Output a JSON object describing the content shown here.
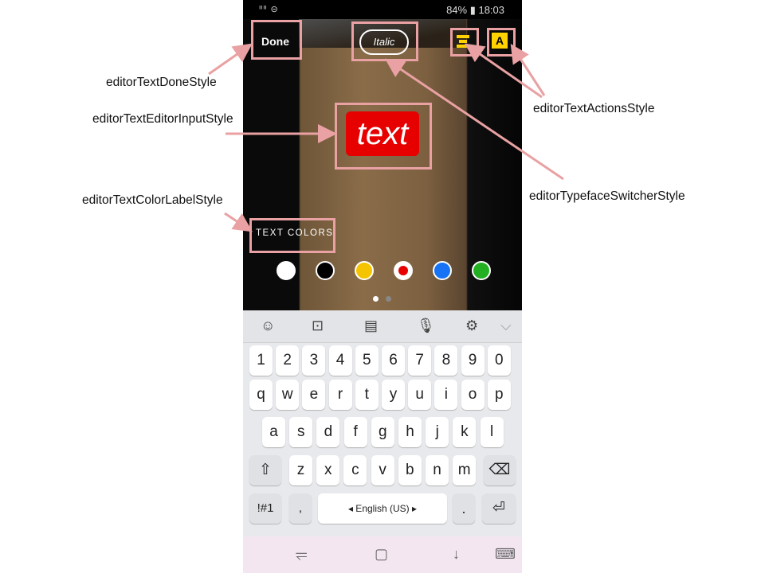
{
  "status_bar": {
    "left": "ᐦᐦ ⊝",
    "right": "84% ▮ 18:03"
  },
  "editor": {
    "done_label": "Done",
    "typeface_label": "Italic",
    "text_content": "text",
    "colors_label": "TEXT COLORS",
    "swatch_colors": [
      "#ffffff",
      "#000000",
      "#f5c400",
      "#e60000",
      "#1673f5",
      "#22b022"
    ],
    "selected_swatch": 3,
    "page_indicator": {
      "pages": 2,
      "current": 1
    }
  },
  "keyboard": {
    "toolbar_icons": [
      "emoji-icon",
      "sticker-icon",
      "clipboard-icon",
      "mic-icon",
      "settings-icon",
      "collapse-icon"
    ],
    "row_numbers": [
      "1",
      "2",
      "3",
      "4",
      "5",
      "6",
      "7",
      "8",
      "9",
      "0"
    ],
    "row1": [
      "q",
      "w",
      "e",
      "r",
      "t",
      "y",
      "u",
      "i",
      "o",
      "p"
    ],
    "row2": [
      "a",
      "s",
      "d",
      "f",
      "g",
      "h",
      "j",
      "k",
      "l"
    ],
    "row3": [
      "z",
      "x",
      "c",
      "v",
      "b",
      "n",
      "m"
    ],
    "symbols_label": "!#1",
    "comma_label": ",",
    "space_label": "◂ English (US) ▸",
    "period_label": "."
  },
  "annotations": {
    "done": "editorTextDoneStyle",
    "input": "editorTextEditorInputStyle",
    "color_label": "editorTextColorLabelStyle",
    "actions": "editorTextActionsStyle",
    "typeface": "editorTypefaceSwitcherStyle"
  },
  "colors": {
    "highlight": "#e9a1a3",
    "accent_yellow": "#ffd200"
  }
}
